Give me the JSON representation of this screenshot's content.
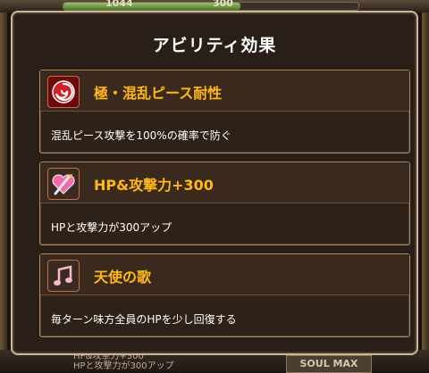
{
  "background": {
    "hp_label": "1044",
    "hp_secondary": "300",
    "bottom_text_line1": "HP&攻撃力+300",
    "bottom_text_line2": "HPと攻撃力が300アップ",
    "soul_button": "SOUL MAX"
  },
  "modal": {
    "title": "アビリティ効果",
    "abilities": [
      {
        "name": "極・混乱ピース耐性",
        "description": "混乱ピース攻撃を100%の確率で防ぐ",
        "icon": "swirl-icon"
      },
      {
        "name": "HP&攻撃力+300",
        "description": "HPと攻撃力が300アップ",
        "icon": "heart-sword-icon"
      },
      {
        "name": "天使の歌",
        "description": "毎ターン味方全員のHPを少し回復する",
        "icon": "music-note-icon"
      }
    ]
  },
  "colors": {
    "accent": "#ffb81c",
    "border": "#a88a5e",
    "panel": "#2a1f18"
  }
}
